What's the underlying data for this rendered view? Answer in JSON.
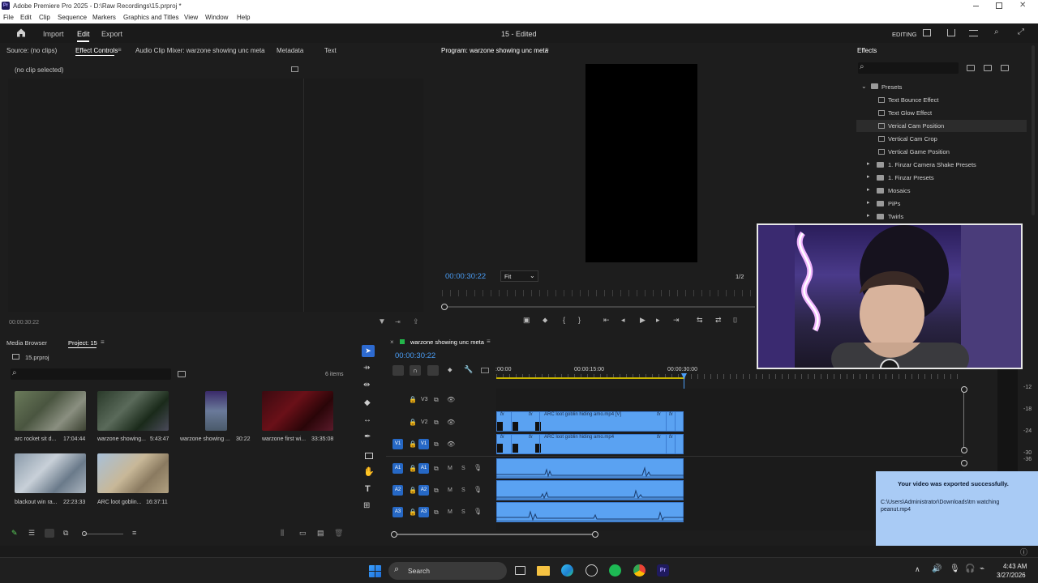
{
  "window": {
    "title": "Adobe Premiere Pro 2025 - D:\\Raw Recordings\\15.prproj *",
    "app_icon": "Pr"
  },
  "menu": [
    "File",
    "Edit",
    "Clip",
    "Sequence",
    "Markers",
    "Graphics and Titles",
    "View",
    "Window",
    "Help"
  ],
  "header": {
    "tabs": [
      "Import",
      "Edit",
      "Export"
    ],
    "active_tab": "Edit",
    "project_title": "15 - Edited",
    "workspace": "EDITING"
  },
  "source_panel": {
    "tabs": [
      "Source: (no clips)",
      "Effect Controls",
      "Audio Clip Mixer: warzone showing unc meta",
      "Metadata",
      "Text"
    ],
    "active_tab": "Effect Controls",
    "no_clip": "(no clip selected)",
    "timecode": "00:00:30:22"
  },
  "program_panel": {
    "title": "Program: warzone showing unc meta",
    "timecode": "00:00:30:22",
    "fit": "Fit",
    "resolution": "1/2"
  },
  "effects_panel": {
    "title": "Effects",
    "presets_label": "Presets",
    "items": [
      "Text Bounce Effect",
      "Text Glow Effect",
      "Verical Cam Position",
      "Vertical Cam Crop",
      "Vertical Game Position"
    ],
    "folders": [
      "1. Finzar Camera Shake Presets",
      "1. Finzar Presets",
      "Mosaics",
      "PiPs",
      "Twirls"
    ]
  },
  "project_panel": {
    "tabs": [
      "Media Browser",
      "Project: 15"
    ],
    "active_tab": "Project: 15",
    "file": "15.prproj",
    "item_count": "6 items",
    "items": [
      {
        "name": "arc rocket sit d...",
        "duration": "17:04:44"
      },
      {
        "name": "warzone showing...",
        "duration": "5:43:47"
      },
      {
        "name": "warzone showing ...",
        "duration": "30:22"
      },
      {
        "name": "warzone first wi...",
        "duration": "33:35:08"
      },
      {
        "name": "blackout win ra...",
        "duration": "22:23:33"
      },
      {
        "name": "ARC loot goblin...",
        "duration": "16:37:11"
      }
    ]
  },
  "timeline": {
    "sequence": "warzone showing unc meta",
    "timecode": "00:00:30:22",
    "ruler": [
      ":00:00",
      "00:00:15:00",
      "00:00:30:00"
    ],
    "video_tracks": [
      "V3",
      "V2",
      "V1"
    ],
    "audio_tracks": [
      "A1",
      "A2",
      "A3"
    ],
    "clip_v2": "ARC loot goblin hiding amo.mp4 [V]",
    "clip_v1": "ARC loot goblin hiding amo.mp4",
    "track_buttons": {
      "mute": "M",
      "solo": "S"
    },
    "fx": "fx"
  },
  "meter": {
    "labels": [
      "-12",
      "-18",
      "-24",
      "-30",
      "-36"
    ]
  },
  "notification": {
    "title": "Your video was exported successfully.",
    "path": "C:\\Users\\Administrator\\Downloads\\tm watching peanut.mp4"
  },
  "taskbar": {
    "search": "Search",
    "time": "4:43 AM",
    "date": "3/27/2026"
  }
}
